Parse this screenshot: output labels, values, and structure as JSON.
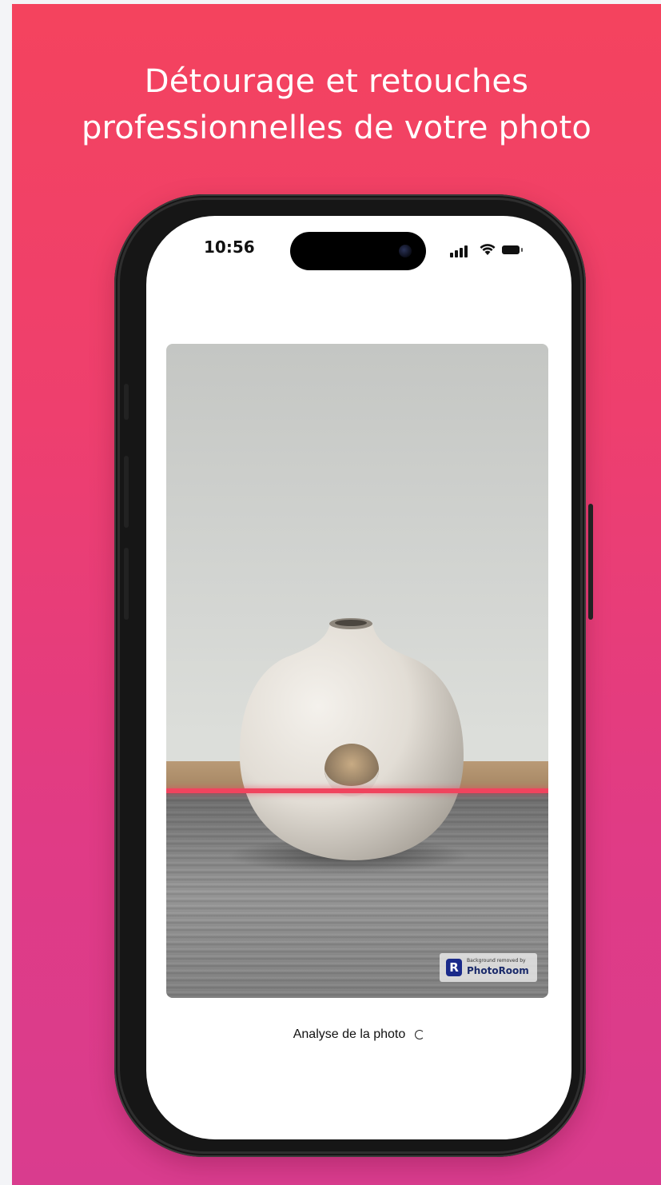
{
  "headline": {
    "line1": "Détourage et retouches",
    "line2": "professionnelles de votre photo"
  },
  "status_bar": {
    "time": "10:56",
    "icons": [
      "signal-icon",
      "wifi-icon",
      "battery-icon"
    ]
  },
  "photo": {
    "subject": "vase-image",
    "watermark": {
      "small_text": "Background removed by",
      "brand": "PhotoRoom",
      "logo_letter": "R"
    }
  },
  "status": {
    "label": "Analyse de la photo"
  },
  "colors": {
    "gradient_top": "#f4435e",
    "gradient_bottom": "#d93c8e",
    "scan_line": "#f0445e",
    "brand_blue": "#1a2a8a"
  }
}
